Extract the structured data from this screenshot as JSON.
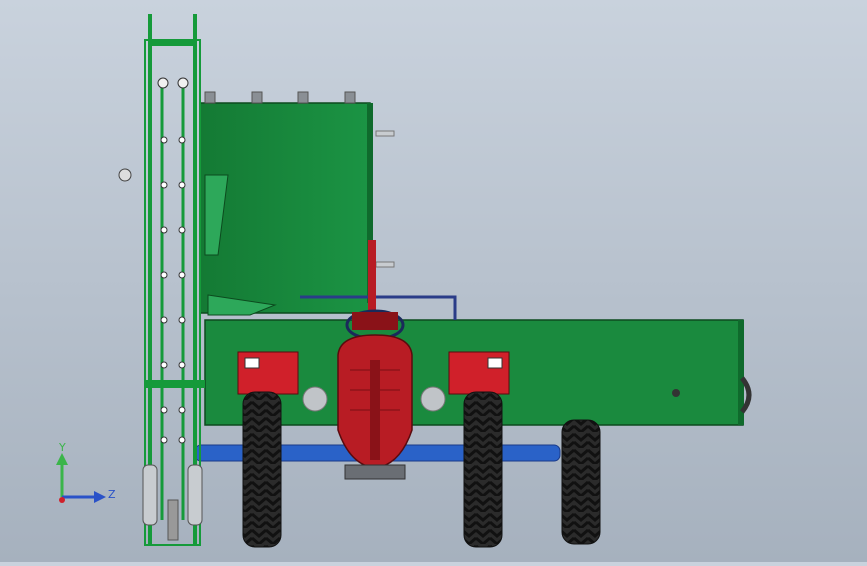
{
  "viewport": {
    "background_top": "#c9d2dd",
    "background_bottom": "#a6b1be"
  },
  "model": {
    "body_color": "#1a8a3e",
    "frame_color": "#159a3a",
    "tractor_color": "#b81c24",
    "axle_color": "#2a62c8",
    "tire_color": "#2b2b2b",
    "hub_color": "#c0c4c8"
  },
  "triad": {
    "y_label": "Y",
    "z_label": "Z",
    "y_color": "#3bb54a",
    "z_color": "#2a52c8",
    "x_color": "#d0202a"
  }
}
